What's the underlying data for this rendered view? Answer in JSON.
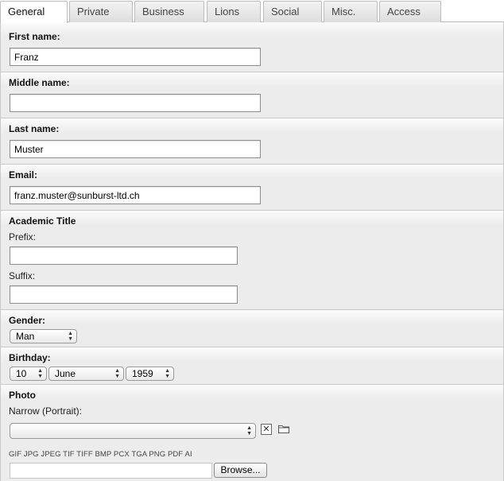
{
  "tabs": [
    {
      "label": "General",
      "active": true
    },
    {
      "label": "Private"
    },
    {
      "label": "Business"
    },
    {
      "label": "Lions"
    },
    {
      "label": "Social"
    },
    {
      "label": "Misc."
    },
    {
      "label": "Access"
    }
  ],
  "first_name": {
    "label": "First name:",
    "value": "Franz"
  },
  "middle_name": {
    "label": "Middle name:",
    "value": ""
  },
  "last_name": {
    "label": "Last name:",
    "value": "Muster"
  },
  "email": {
    "label": "Email:",
    "value": "franz.muster@sunburst-ltd.ch"
  },
  "academic_title": {
    "label": "Academic Title",
    "prefix_label": "Prefix:",
    "prefix_value": "",
    "suffix_label": "Suffix:",
    "suffix_value": ""
  },
  "gender": {
    "label": "Gender:",
    "selected": "Man"
  },
  "birthday": {
    "label": "Birthday:",
    "day": "10",
    "month": "June",
    "year": "1959"
  },
  "photo": {
    "label": "Photo",
    "narrow_label": "Narrow (Portrait):",
    "selected": "",
    "file_types": "GIF JPG JPEG TIF TIFF BMP PCX TGA PNG PDF AI",
    "browse_label": "Browse..."
  },
  "icons": {
    "clear": "close-icon",
    "folder": "folder-icon",
    "select_arrows": "up-down-arrows-icon"
  }
}
